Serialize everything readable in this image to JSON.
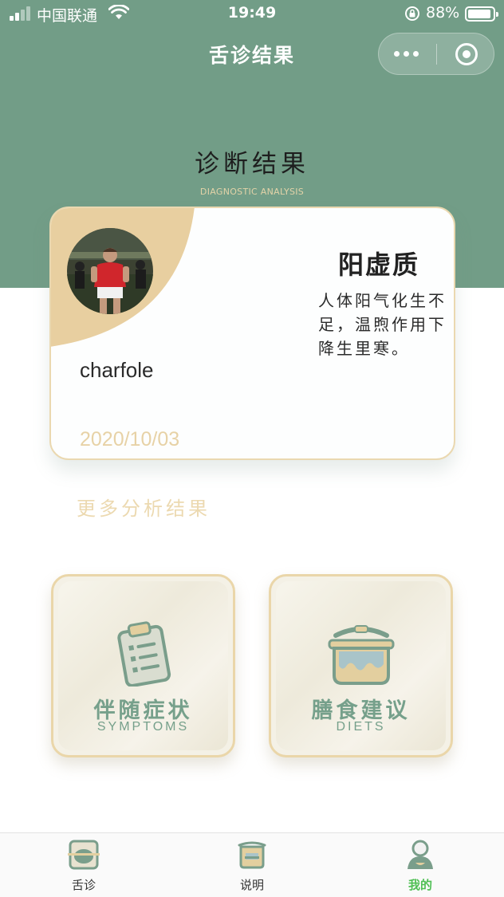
{
  "status_bar": {
    "carrier": "中国联通",
    "time": "19:49",
    "battery": "88%"
  },
  "nav": {
    "title": "舌诊结果"
  },
  "heading": {
    "title": "诊断结果",
    "subtitle": "DIAGNOSTIC ANALYSIS"
  },
  "result_card": {
    "username": "charfole",
    "date": "2020/10/03",
    "constitution": "阳虚质",
    "description": "人体阳气化生不足，温煦作用下降生里寒。"
  },
  "more_results": "更多分析结果",
  "tiles": [
    {
      "title": "伴随症状",
      "subtitle": "SYMPTOMS",
      "icon": "clipboard-icon"
    },
    {
      "title": "膳食建议",
      "subtitle": "DIETS",
      "icon": "pot-icon"
    }
  ],
  "tabbar": {
    "items": [
      {
        "label": "舌诊",
        "icon": "tongue-scan-icon"
      },
      {
        "label": "说明",
        "icon": "manual-icon"
      },
      {
        "label": "我的",
        "icon": "profile-icon"
      }
    ],
    "active": "我的"
  },
  "colors": {
    "primary_green": "#729d87",
    "accent_gold": "#e8d3a3",
    "active_tab": "#4fbf54"
  }
}
